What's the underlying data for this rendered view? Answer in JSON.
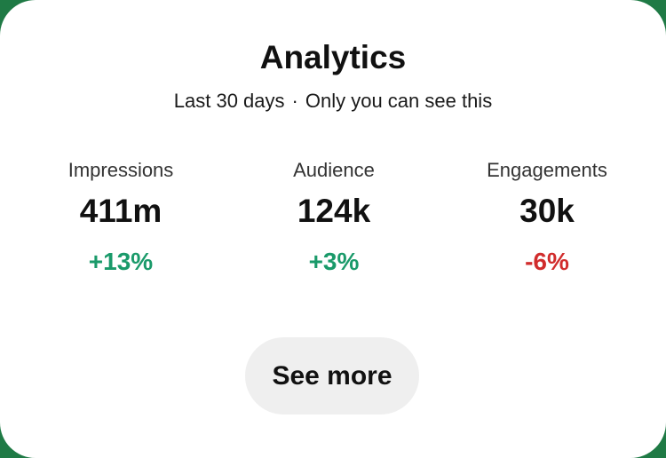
{
  "header": {
    "title": "Analytics",
    "subtitle_period": "Last 30 days",
    "subtitle_separator": "·",
    "subtitle_visibility": "Only you can see this"
  },
  "stats": [
    {
      "label": "Impressions",
      "value": "411m",
      "change": "+13%",
      "trend": "up"
    },
    {
      "label": "Audience",
      "value": "124k",
      "change": "+3%",
      "trend": "up"
    },
    {
      "label": "Engagements",
      "value": "30k",
      "change": "-6%",
      "trend": "down"
    }
  ],
  "actions": {
    "see_more_label": "See more"
  },
  "colors": {
    "positive": "#1a9a6a",
    "negative": "#d12c2c",
    "background_accent": "#1f7a45",
    "button_bg": "#efefef"
  }
}
